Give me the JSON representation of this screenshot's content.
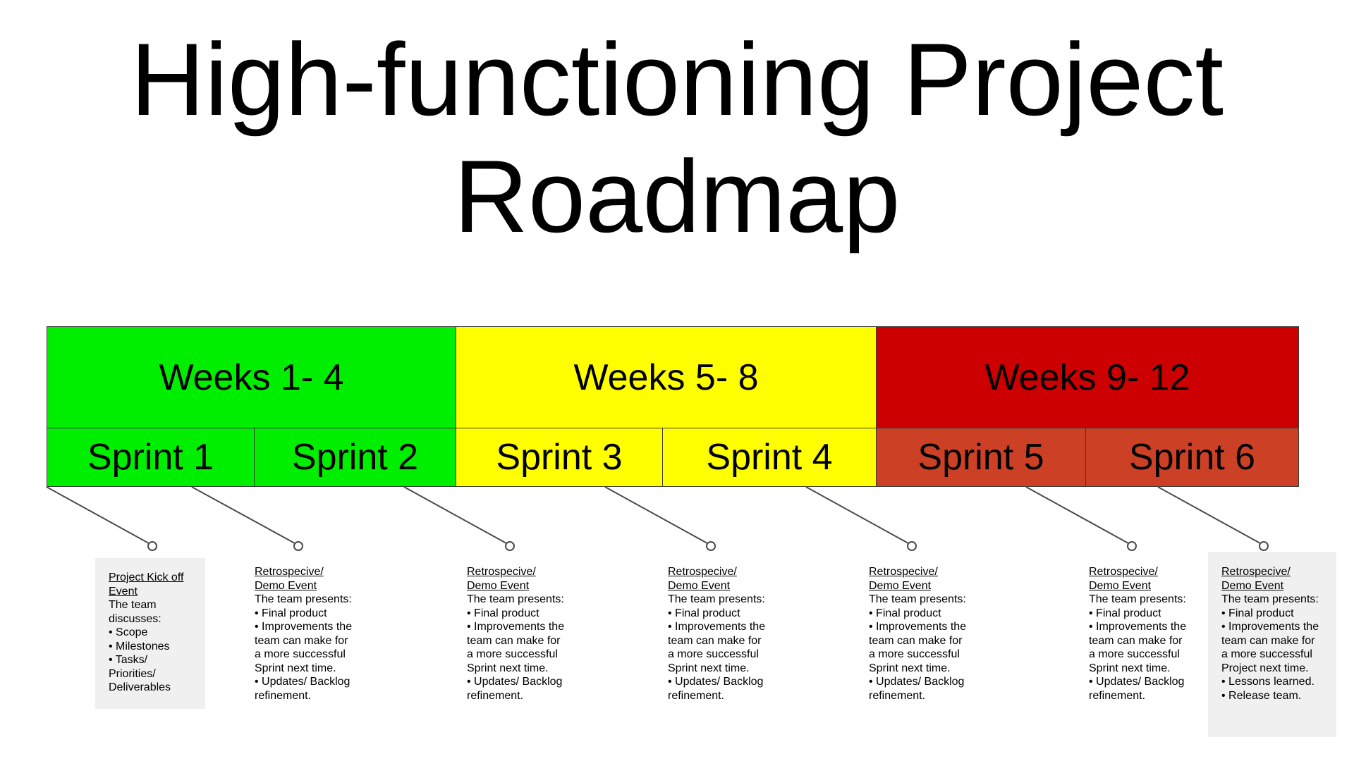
{
  "title": {
    "line1": "High-functioning Project",
    "line2": "Roadmap"
  },
  "colors": {
    "green": "#00ee00",
    "yellow": "#ffff00",
    "red": "#cc0000",
    "red_sprint": "#cc4125",
    "note_bg": "#f0f0f0"
  },
  "periods": [
    {
      "label": "Weeks 1- 4",
      "color": "#00ee00"
    },
    {
      "label": "Weeks 5- 8",
      "color": "#ffff00"
    },
    {
      "label": "Weeks 9- 12",
      "color": "#cc0000"
    }
  ],
  "sprints": [
    {
      "label": "Sprint 1",
      "color": "#00ee00"
    },
    {
      "label": "Sprint 2",
      "color": "#00ee00"
    },
    {
      "label": "Sprint 3",
      "color": "#ffff00"
    },
    {
      "label": "Sprint 4",
      "color": "#ffff00"
    },
    {
      "label": "Sprint 5",
      "color": "#cc4125"
    },
    {
      "label": "Sprint 6",
      "color": "#cc4125"
    }
  ],
  "notes": [
    {
      "heading": "Project Kick off Event",
      "lines": [
        "The team",
        "discusses:",
        "• Scope",
        "• Milestones",
        "• Tasks/",
        "Priorities/",
        "Deliverables"
      ]
    },
    {
      "heading": "Retrospecive/ Demo Event",
      "lines": [
        "The team presents:",
        "• Final product",
        "• Improvements the",
        "team can make for",
        "a more successful",
        "Sprint next time.",
        "• Updates/ Backlog",
        "refinement."
      ]
    },
    {
      "heading": "Retrospecive/ Demo Event",
      "lines": [
        "The team presents:",
        "• Final product",
        "• Improvements the",
        "team can make for",
        "a more successful",
        "Sprint next time.",
        "• Updates/ Backlog",
        "refinement."
      ]
    },
    {
      "heading": "Retrospecive/ Demo Event",
      "lines": [
        "The team presents:",
        "• Final product",
        "• Improvements the",
        "team can make for",
        "a more successful",
        "Sprint next time.",
        "• Updates/ Backlog",
        "refinement."
      ]
    },
    {
      "heading": "Retrospecive/ Demo Event",
      "lines": [
        "The team presents:",
        "• Final product",
        "• Improvements the",
        "team can make for",
        "a more successful",
        "Sprint next time.",
        "• Updates/ Backlog",
        "refinement."
      ]
    },
    {
      "heading": "Retrospecive/ Demo Event",
      "lines": [
        "The team presents:",
        "• Final product",
        "• Improvements the",
        "team can make for",
        "a more successful",
        "Sprint next time.",
        "• Updates/ Backlog",
        "refinement."
      ]
    },
    {
      "heading": "Retrospecive/ Demo Event",
      "lines": [
        "The team presents:",
        "• Final product",
        "• Improvements the",
        "team can make for",
        "a more successful",
        "Project next time.",
        "• Lessons learned.",
        "• Release team."
      ]
    }
  ]
}
